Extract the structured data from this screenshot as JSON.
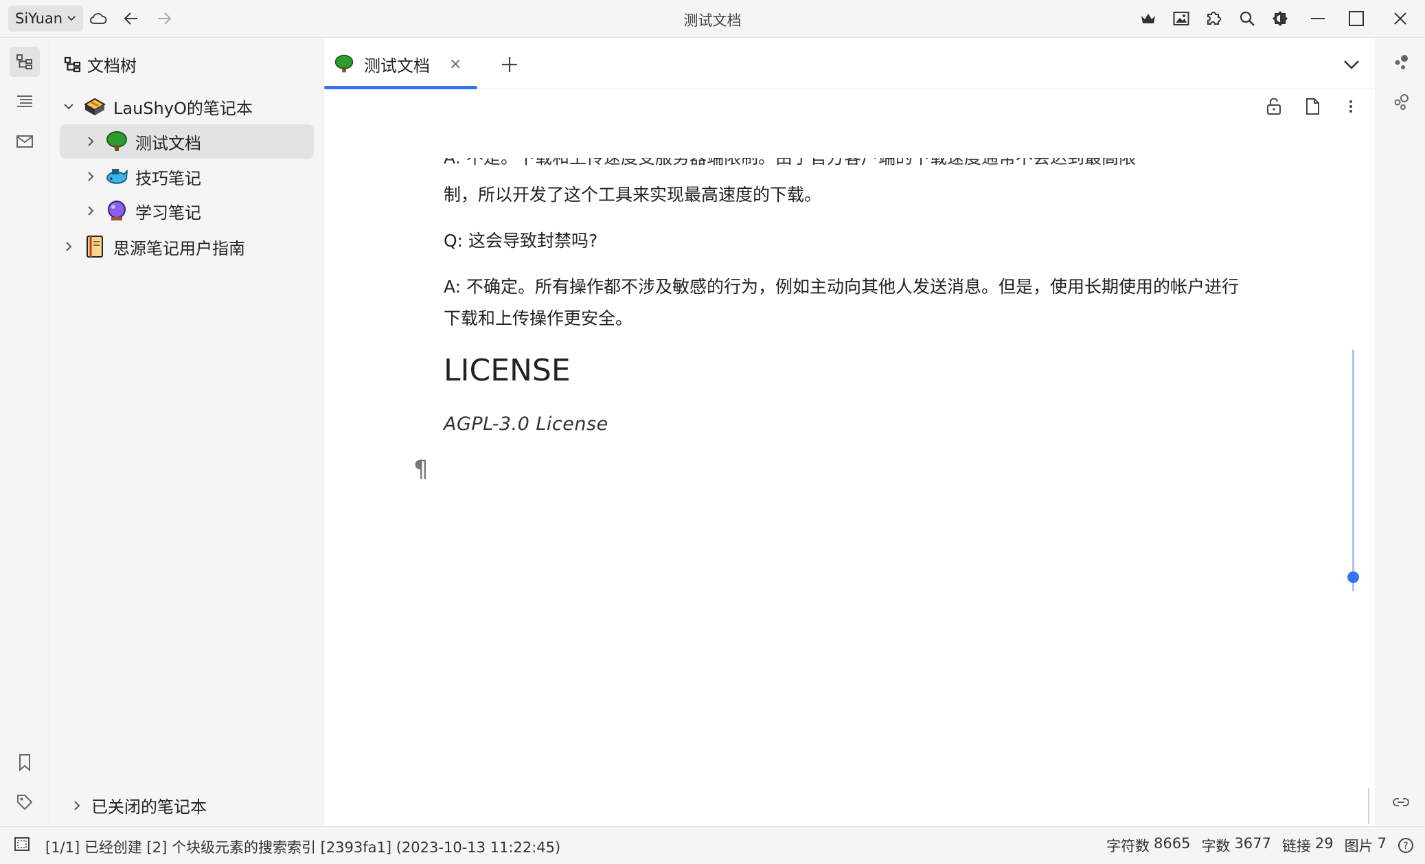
{
  "titlebar": {
    "workspace": "SiYuan",
    "title": "测试文档",
    "icons": [
      "cloud-icon",
      "back-arrow-icon",
      "forward-arrow-icon",
      "crown-icon",
      "image-icon",
      "puzzle-icon",
      "search-icon",
      "contrast-icon",
      "minimize-icon",
      "maximize-icon",
      "close-icon"
    ]
  },
  "left_dock": {
    "icons": [
      "file-tree-icon",
      "outline-icon",
      "inbox-icon",
      "bookmark-icon",
      "tag-icon"
    ]
  },
  "file_tree": {
    "header": "文档树",
    "notebook": "LauShyO的笔记本",
    "items": [
      {
        "label": "测试文档",
        "icon": "tree-emoji"
      },
      {
        "label": "技巧笔记",
        "icon": "whale-emoji"
      },
      {
        "label": "学习笔记",
        "icon": "crystal-ball-emoji"
      }
    ],
    "guide_notebook": "思源笔记用户指南",
    "closed_notebooks": "已关闭的笔记本"
  },
  "editor": {
    "tab_label": "测试文档",
    "tab_close": "×",
    "clipped_line": "A: 不是。下载和上传速度受服务器端限制。由于官方客户端的下载速度通常不会达到最高限",
    "para1": "制，所以开发了这个工具来实现最高速度的下载。",
    "question": "Q: 这会导致封禁吗?",
    "answer": "A: 不确定。所有操作都不涉及敏感的行为，例如主动向其他人发送消息。但是，使用长期使用的帐户进行下载和上传操作更安全。",
    "heading": "LICENSE",
    "license_text": "AGPL-3.0 License",
    "pilcrow": "¶"
  },
  "statusbar": {
    "message": "[1/1] 已经创建 [2] 个块级元素的搜索索引 [2393fa1] (2023-10-13 11:22:45)",
    "stats": [
      {
        "label": "字符数",
        "value": "8665"
      },
      {
        "label": "字数",
        "value": "3677"
      },
      {
        "label": "链接",
        "value": "29"
      },
      {
        "label": "图片",
        "value": "7"
      }
    ],
    "help": "?"
  },
  "colors": {
    "accent": "#3575f0",
    "panel_bg": "#f5f5f5",
    "selected_bg": "#e3e3e3"
  }
}
